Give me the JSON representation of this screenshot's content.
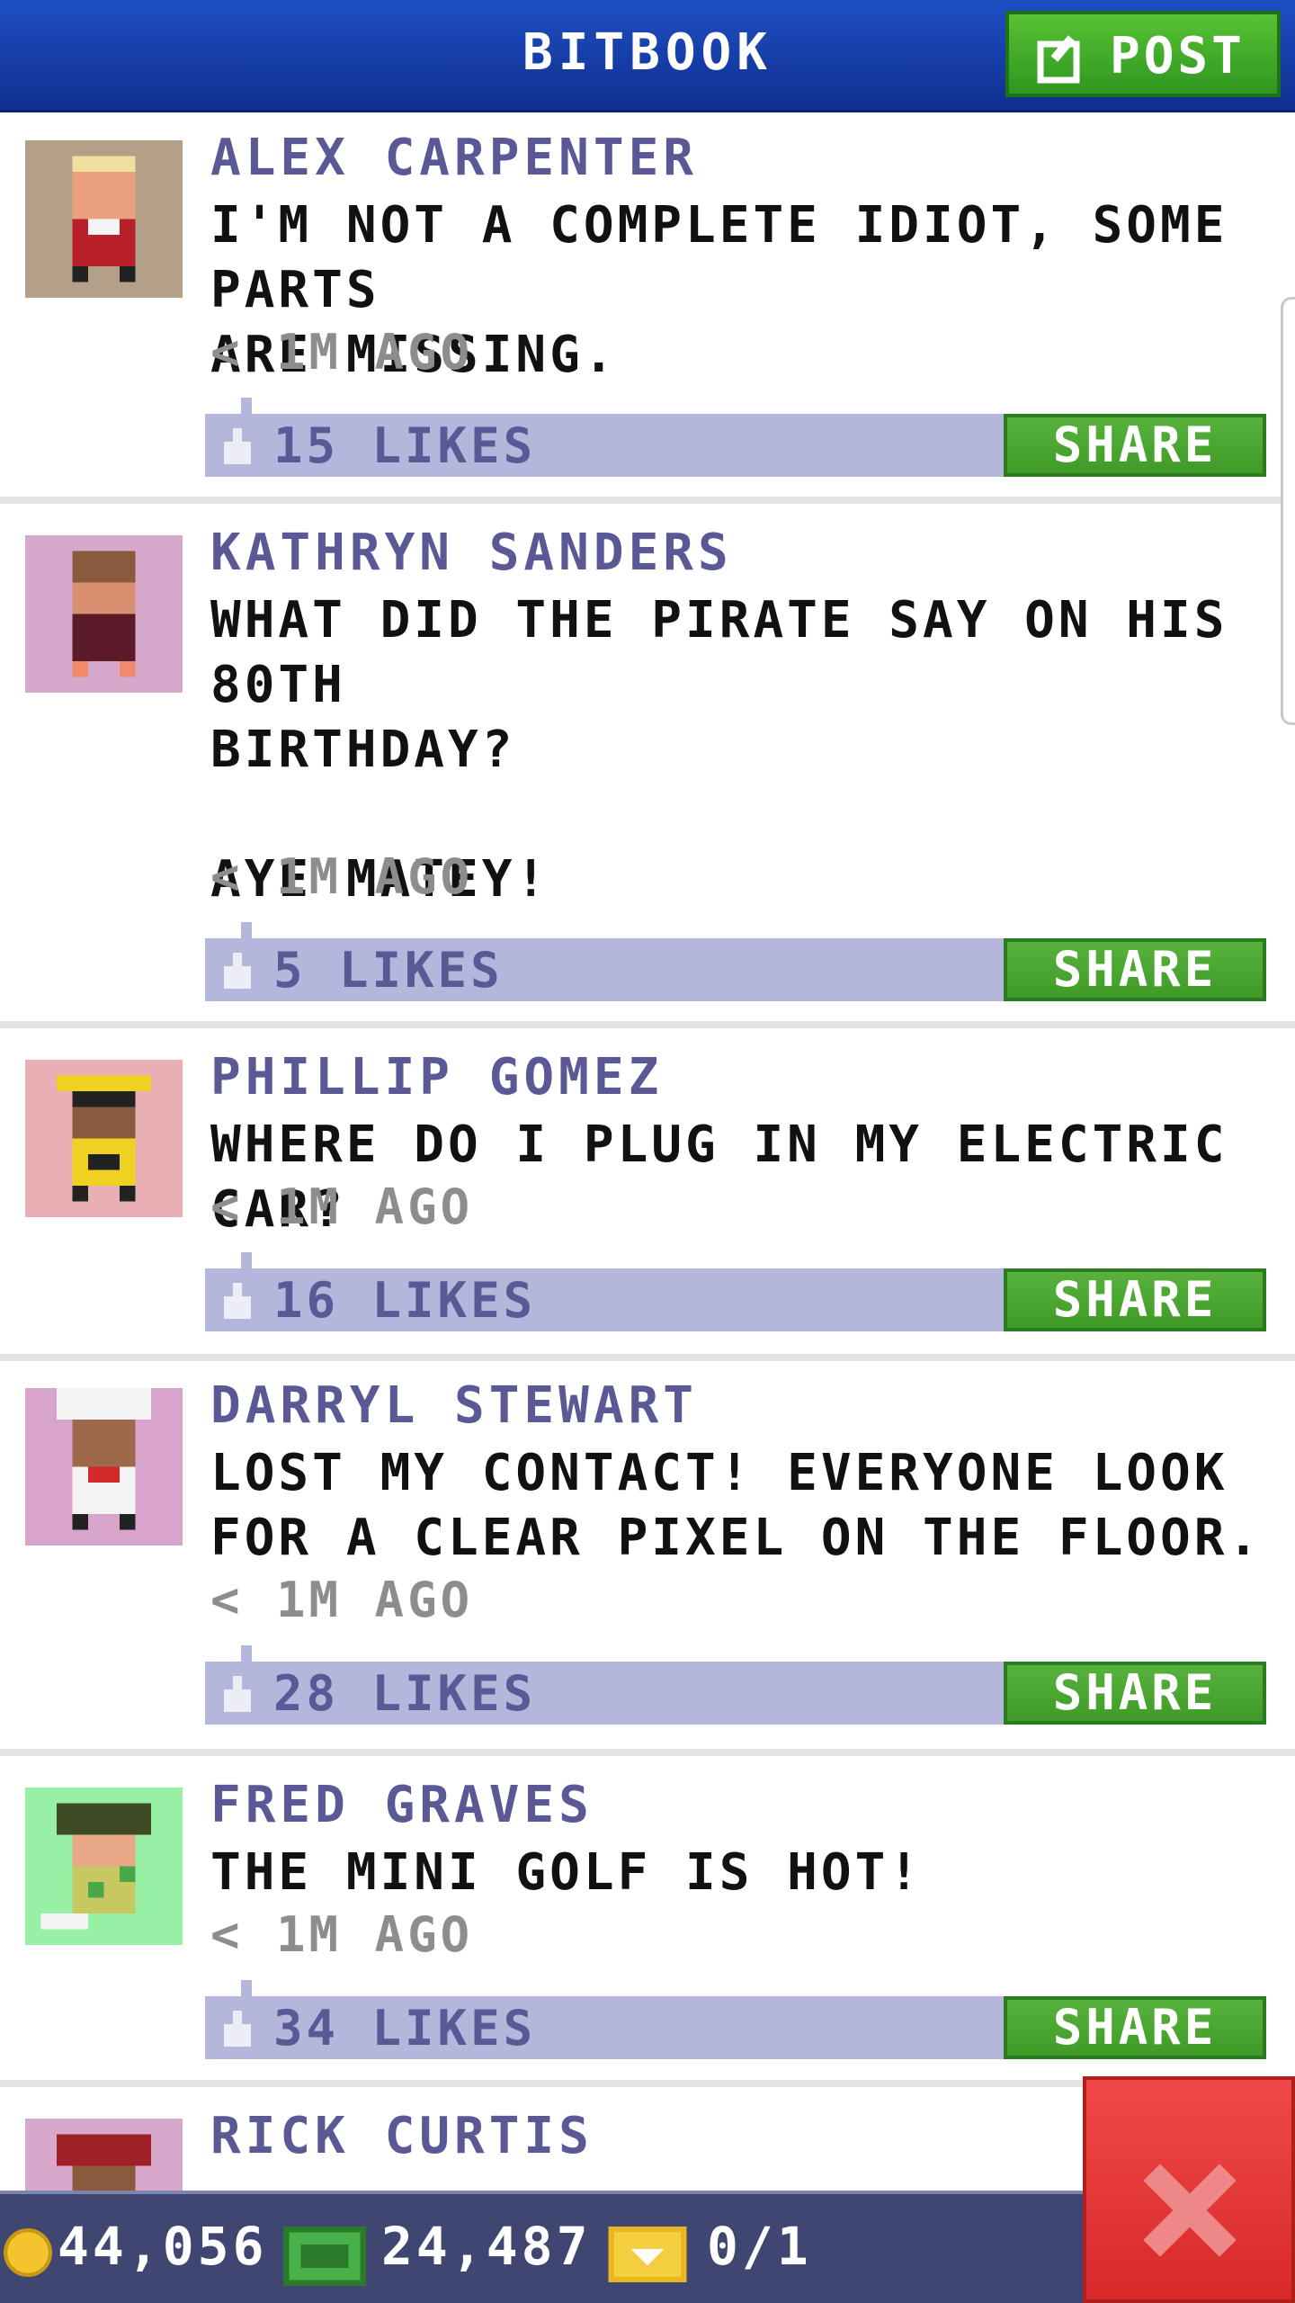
{
  "header": {
    "title": "BITBOOK",
    "post_label": "POST"
  },
  "posts": [
    {
      "author": "ALEX CARPENTER",
      "text": "I'M NOT A COMPLETE IDIOT, SOME PARTS\nARE MISSING.",
      "time": "< 1M AGO",
      "likes": "15 LIKES",
      "share": "SHARE",
      "avatar_bg": "#b4a088"
    },
    {
      "author": "KATHRYN SANDERS",
      "text": "WHAT DID THE PIRATE SAY ON HIS 80TH\nBIRTHDAY?\n\nAYE MATEY!",
      "time": "< 1M AGO",
      "likes": "5 LIKES",
      "share": "SHARE",
      "avatar_bg": "#d8a8cc"
    },
    {
      "author": "PHILLIP GOMEZ",
      "text": "WHERE DO I PLUG IN MY ELECTRIC CAR?",
      "time": "< 1M AGO",
      "likes": "16 LIKES",
      "share": "SHARE",
      "avatar_bg": "#e8b0b4"
    },
    {
      "author": "DARRYL STEWART",
      "text": "LOST MY CONTACT! EVERYONE LOOK\nFOR A CLEAR PIXEL ON THE FLOOR.",
      "time": "< 1M AGO",
      "likes": "28 LIKES",
      "share": "SHARE",
      "avatar_bg": "#d8a4cc"
    },
    {
      "author": "FRED GRAVES",
      "text": "THE MINI GOLF IS HOT!",
      "time": "< 1M AGO",
      "likes": "34 LIKES",
      "share": "SHARE",
      "avatar_bg": "#98f0a4"
    },
    {
      "author": "RICK CURTIS",
      "avatar_bg": "#d8a8cc"
    }
  ],
  "footer": {
    "coins": "44,056",
    "bux": "24,487",
    "tickets": "0/1"
  },
  "colors": {
    "header": "#1a45b8",
    "name": "#5a5895",
    "like_bar": "#b4b6dc",
    "share": "#4aa82f",
    "footer": "#3e4671",
    "close": "#e23a3a"
  },
  "icons": {
    "post": "edit-icon",
    "like": "thumbs-up-icon",
    "coin": "coin-icon",
    "bux": "bux-icon",
    "ticket": "ticket-icon",
    "close": "close-icon"
  }
}
